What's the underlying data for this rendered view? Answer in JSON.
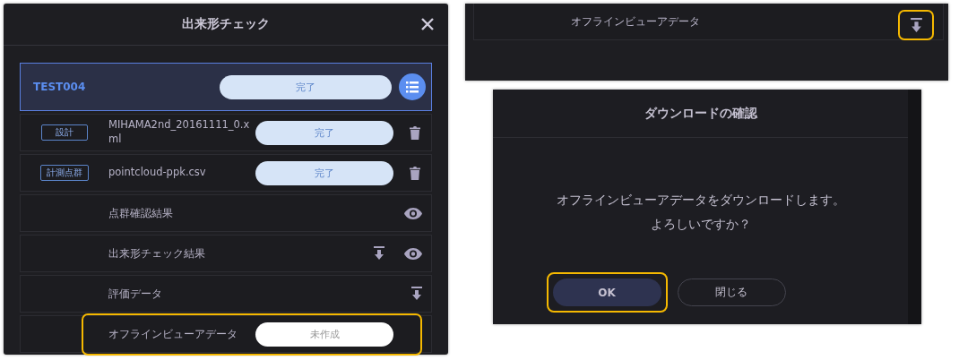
{
  "check_dialog": {
    "title": "出来形チェック",
    "project": {
      "name": "TEST004",
      "status": "完了",
      "selected": true
    },
    "files": [
      {
        "tag": "設計",
        "name": "MIHAMA2nd_20161111_0.xml",
        "status": "完了"
      },
      {
        "tag": "計測点群",
        "name": "pointcloud-ppk.csv",
        "status": "完了"
      }
    ],
    "results": [
      {
        "label": "点群確認結果",
        "download": false,
        "view": true,
        "highlighted": false
      },
      {
        "label": "出来形チェック結果",
        "download": true,
        "view": true,
        "highlighted": false
      },
      {
        "label": "評価データ",
        "download": true,
        "view": false,
        "highlighted": false
      },
      {
        "label": "オフラインビューアデータ",
        "status": "未作成",
        "download": false,
        "view": false,
        "highlighted": true
      }
    ]
  },
  "offline_row": {
    "label": "オフラインビューアデータ",
    "download": true,
    "highlighted": true
  },
  "confirm_dialog": {
    "title": "ダウンロードの確認",
    "message_lines": [
      "オフラインビューアデータをダウンロードします。",
      "よろしいですか？"
    ],
    "buttons": [
      {
        "label": "OK",
        "kind": "primary",
        "highlighted": true
      },
      {
        "label": "閉じる",
        "kind": "secondary",
        "highlighted": false
      }
    ]
  }
}
